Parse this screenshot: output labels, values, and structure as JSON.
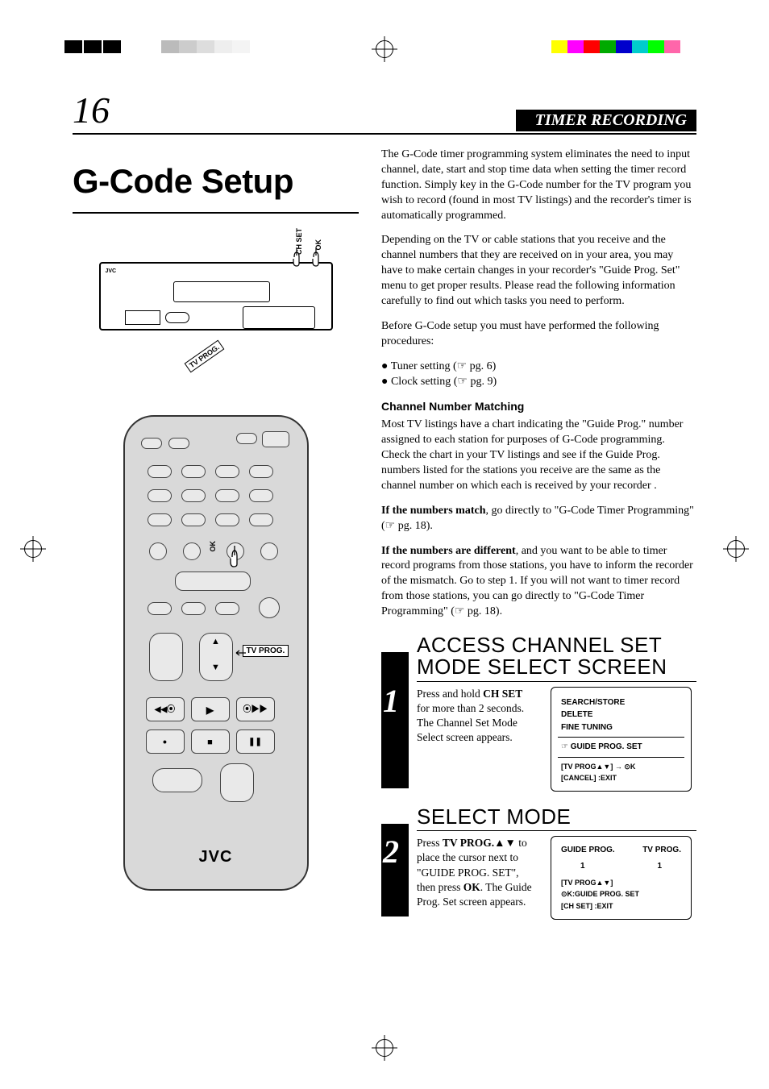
{
  "page_number": "16",
  "section_bar": "TIMER RECORDING",
  "main_title": "G-Code Setup",
  "vcr_labels": {
    "ch_set": "CH SET",
    "ok": "OK",
    "tv_prog": "TV PROG."
  },
  "remote": {
    "tv_prog_label": "TV PROG.",
    "ok_label": "OK",
    "brand": "JVC"
  },
  "intro": {
    "p1": "The G-Code timer programming system eliminates the need to input channel, date, start and stop time data when setting the timer record function. Simply key in the G-Code number for the TV program you wish to record (found in most TV listings) and the recorder's timer is automatically programmed.",
    "p2": "Depending on the TV or cable stations that you receive and the channel numbers that they are received on in your area, you may have to make certain changes in your recorder's \"Guide Prog. Set\" menu to get proper results. Please read the following information carefully to find out which tasks you need to perform.",
    "p3": "Before G-Code setup you must have performed the following procedures:",
    "bullets": [
      "Tuner setting (☞ pg. 6)",
      "Clock setting (☞ pg. 9)"
    ]
  },
  "channel_matching": {
    "heading": "Channel Number Matching",
    "p1": "Most TV listings have a chart indicating the \"Guide Prog.\" number assigned to each station for purposes of G-Code programming. Check the chart in your TV listings and see if the Guide Prog. numbers listed for the stations you receive are the same as the channel number on which each is received by your recorder .",
    "p2_lead": "If the numbers match",
    "p2_rest": ", go directly to \"G-Code Timer Programming\" (☞ pg. 18).",
    "p3_lead": "If the numbers are different",
    "p3_rest": ", and you want to be able to timer record programs from those stations, you have to inform the recorder of the mismatch. Go to step 1. If you will not want to timer record from those stations, you can go directly to \"G-Code Timer Programming\" (☞ pg. 18)."
  },
  "steps": [
    {
      "num": "1",
      "title": "ACCESS CHANNEL SET MODE SELECT SCREEN",
      "text_pre": "Press and hold ",
      "text_bold": "CH SET",
      "text_post": " for more than 2 seconds. The Channel Set Mode Select screen appears.",
      "osd": {
        "lines": [
          "SEARCH/STORE",
          "DELETE",
          "FINE TUNING"
        ],
        "pointer_line": "GUIDE PROG. SET",
        "footer1": "[TV PROG▲▼] → ⊙K",
        "footer2": "[CANCEL] :EXIT"
      }
    },
    {
      "num": "2",
      "title": "SELECT MODE",
      "text_pre": "Press ",
      "text_bold": "TV PROG.",
      "text_mid": "▲▼ to place the cursor next to \"GUIDE PROG. SET\", then press ",
      "text_bold2": "OK",
      "text_post": ". The Guide Prog. Set screen appears.",
      "osd": {
        "col1_head": "GUIDE PROG.",
        "col2_head": "TV PROG.",
        "col1_val": "1",
        "col2_val": "1",
        "footer1": "[TV PROG▲▼]",
        "footer2": "⊙K:GUIDE PROG. SET",
        "footer3": "[CH SET]  :EXIT"
      }
    }
  ]
}
